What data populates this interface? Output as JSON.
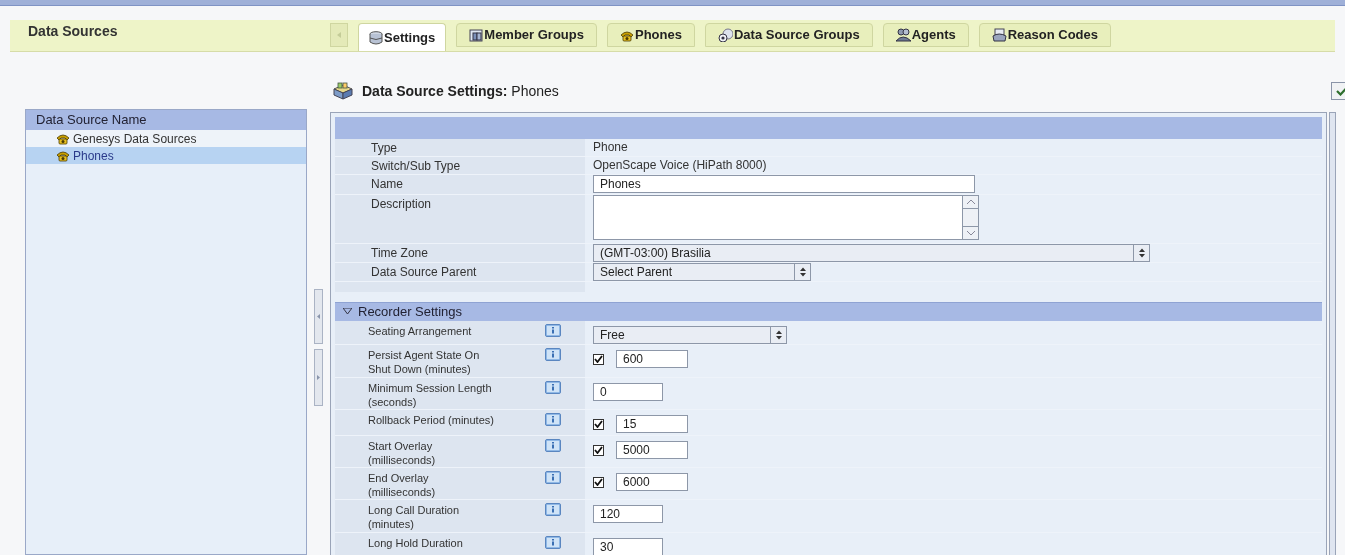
{
  "header": {
    "title": "Data Sources"
  },
  "tabs": [
    {
      "label": "Settings",
      "selected": true
    },
    {
      "label": "Member Groups",
      "selected": false
    },
    {
      "label": "Phones",
      "selected": false
    },
    {
      "label": "Data Source Groups",
      "selected": false
    },
    {
      "label": "Agents",
      "selected": false
    },
    {
      "label": "Reason Codes",
      "selected": false
    }
  ],
  "sidebar": {
    "heading": "Data Source Name",
    "items": [
      {
        "label": "Genesys Data Sources",
        "selected": false
      },
      {
        "label": "Phones",
        "selected": true
      }
    ]
  },
  "page_title": {
    "label": "Data Source Settings:",
    "value": "Phones"
  },
  "general_fields": [
    {
      "label": "Type",
      "kind": "text",
      "value": "Phone"
    },
    {
      "label": "Switch/Sub Type",
      "kind": "text",
      "value": "OpenScape Voice (HiPath 8000)"
    },
    {
      "label": "Name",
      "kind": "input",
      "value": "Phones"
    },
    {
      "label": "Description",
      "kind": "textarea"
    },
    {
      "label": "Time Zone",
      "kind": "wide_select",
      "value": "(GMT-03:00) Brasilia"
    },
    {
      "label": "Data Source Parent",
      "kind": "select",
      "value": "Select Parent"
    }
  ],
  "recorder_settings": {
    "title": "Recorder Settings",
    "expanded": true,
    "fields": [
      {
        "label": "Seating Arrangement",
        "kind": "select",
        "value": "Free"
      },
      {
        "label": "Persist Agent State On Shut Down (minutes)",
        "kind": "checked_input",
        "checked": true,
        "value": "600"
      },
      {
        "label": "Minimum Session Length (seconds)",
        "kind": "input",
        "value": "0"
      },
      {
        "label": "Rollback Period (minutes)",
        "kind": "checked_input",
        "checked": true,
        "value": "15"
      },
      {
        "label": "Start Overlay (milliseconds)",
        "kind": "checked_input",
        "checked": true,
        "value": "5000"
      },
      {
        "label": "End Overlay (milliseconds)",
        "kind": "checked_input",
        "checked": true,
        "value": "6000"
      },
      {
        "label": "Long Call Duration (minutes)",
        "kind": "input",
        "value": "120"
      },
      {
        "label": "Long Hold Duration",
        "kind": "input",
        "value": "30"
      }
    ]
  }
}
